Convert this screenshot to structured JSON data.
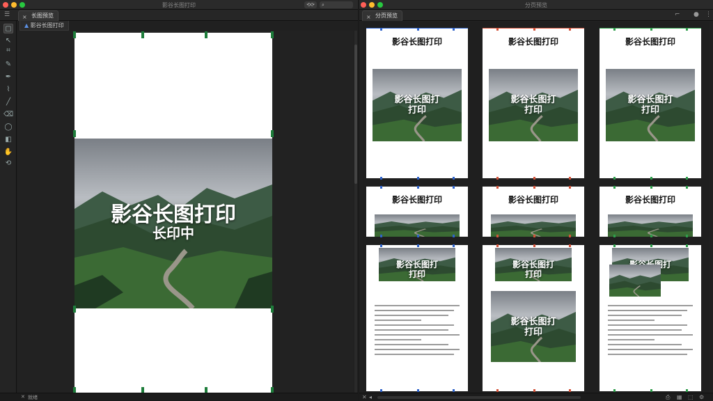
{
  "left_window": {
    "title": "影谷长图打印",
    "toolbar_toggle": "⟲⟳",
    "tab_label": "长图预览",
    "subtab_label": "影谷长图打印",
    "status_label": "就绪",
    "tools": [
      "square-select",
      "arrow",
      "crop",
      "eyedropper",
      "pen",
      "brush",
      "line",
      "eraser",
      "ellipse",
      "fill",
      "hand",
      "rotate"
    ]
  },
  "right_window": {
    "title": "分页预览",
    "tab_label": "分页预览"
  },
  "poster": {
    "title": "影谷长图打印",
    "subtitle": "长印中"
  },
  "thumbnails": {
    "title": "影谷长图打印",
    "overlay_line1": "影谷长图打",
    "overlay_line2": "打印",
    "overlay_short": "打印",
    "marker_colors": [
      "#2f63c9",
      "#d2533a",
      "#2e9d4b"
    ]
  },
  "colors": {
    "handle": "#1e7d3b",
    "accent_blue": "#2f63c9",
    "accent_red": "#d2533a",
    "accent_green": "#2e9d4b"
  }
}
